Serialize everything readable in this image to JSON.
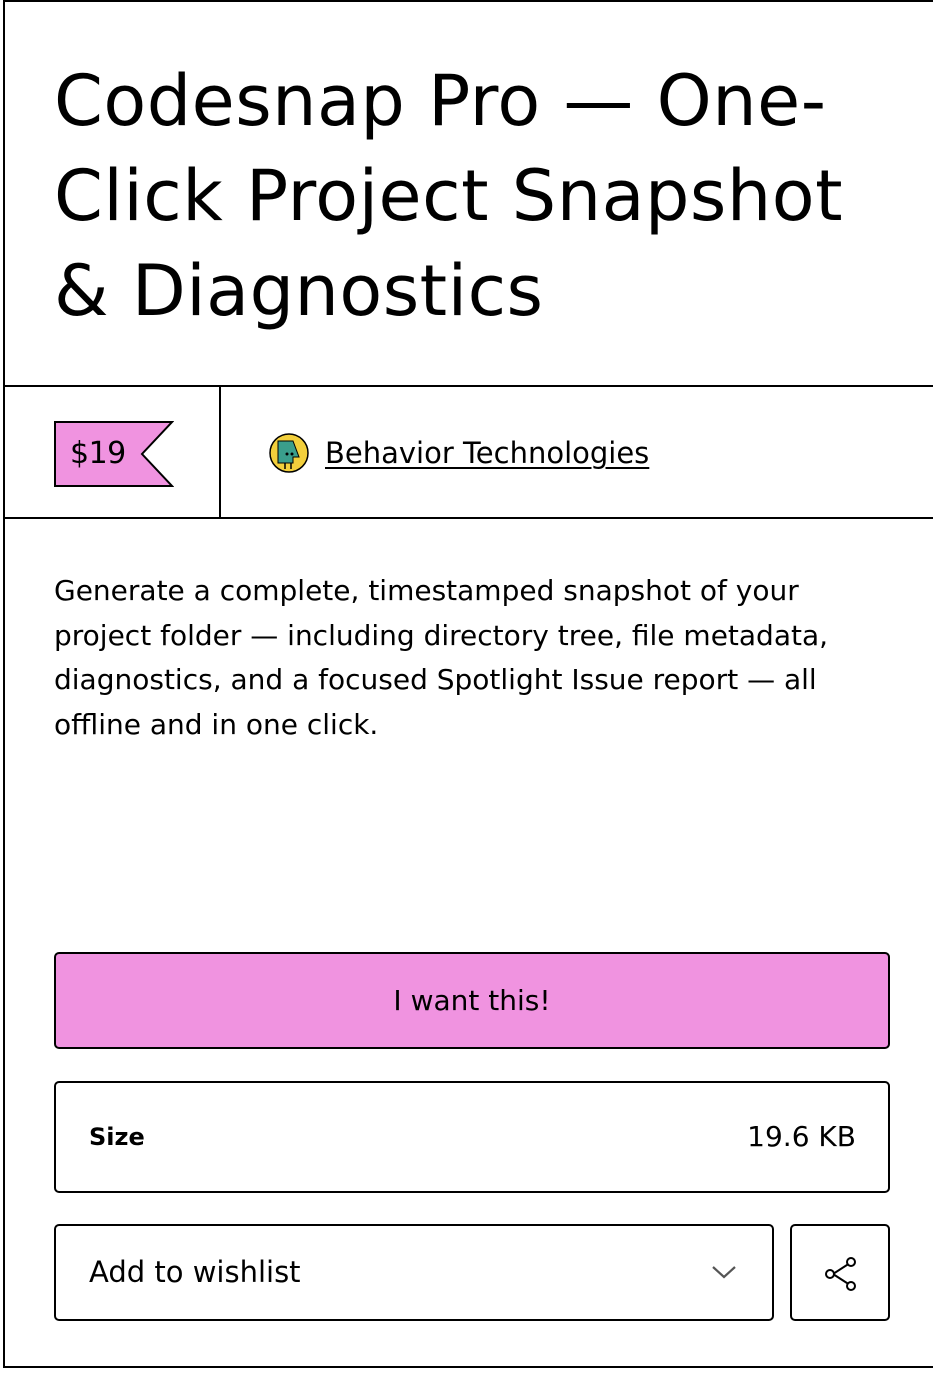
{
  "product": {
    "title": "Codesnap Pro — One-Click Project Snapshot & Diagnostics",
    "price": "$19",
    "description": "Generate a complete, timestamped snapshot of your project folder — including directory tree, file metadata, diagnostics, and a focused Spotlight Issue report — all offline and in one click."
  },
  "seller": {
    "name": "Behavior Technologies",
    "avatar_icon": "creator-avatar"
  },
  "actions": {
    "buy_label": "I want this!",
    "wishlist_label": "Add to wishlist",
    "wishlist_icon": "chevron-down-icon",
    "share_icon": "share-icon"
  },
  "details": {
    "size_label": "Size",
    "size_value": "19.6 KB"
  },
  "colors": {
    "accent": "#f093e0",
    "border": "#000000",
    "background": "#ffffff",
    "avatar_teal": "#3a9e8c",
    "avatar_yellow": "#f2cf3c"
  }
}
